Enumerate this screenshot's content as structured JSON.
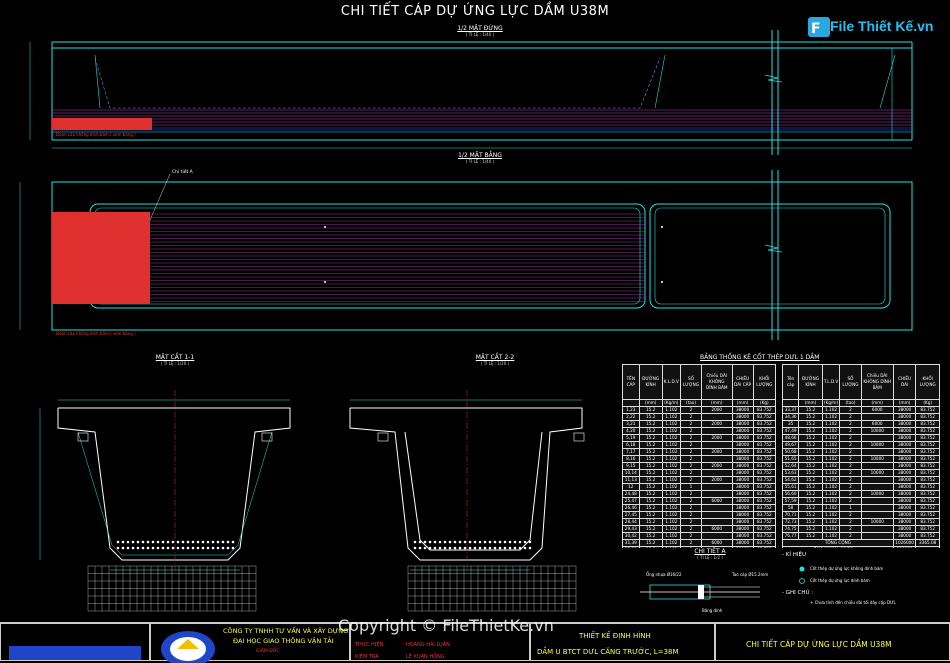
{
  "title": "CHI TIẾT CÁP DỰ ỨNG LỰC DẦM U38M",
  "logo_text": "File Thiết Kế.vn",
  "elevation": {
    "label": "1/2 MẶT ĐỨNG",
    "scale": "( TỈ LỆ : 1/40 )",
    "note": "Đoạn cáp không dính bám ( xem bảng )"
  },
  "plan": {
    "label": "1/2 MẶT BẰNG",
    "scale": "( TỈ LỆ : 1/40 )",
    "callout": "Chi tiết A",
    "note": "Đoạn cáp không dính bám ( xem bảng )"
  },
  "section1": {
    "label": "MẶT CẮT 1-1",
    "scale": "( TỈ LỆ : 1/20 )"
  },
  "section2": {
    "label": "MẶT CẮT 2-2",
    "scale": "( TỈ LỆ : 1/20 )"
  },
  "table_title": "BẢNG THỐNG KÊ CỐT THÉP DƯL 1 DẦM",
  "table_left": {
    "headers": [
      "TÊN CÁP",
      "ĐƯỜNG KÍNH",
      "K.L.D.V",
      "SỐ LƯỢNG",
      "Chiều DÀI KHÔNG DÍNH BÁM",
      "CHIỀU DÀI CÁP",
      "KHỐI LƯỢNG"
    ],
    "units": [
      "",
      "(mm)",
      "(Kg/m)",
      "(tao)",
      "(mm)",
      "(mm)",
      "(Kg)"
    ],
    "rows": [
      [
        "1,23",
        "15.2",
        "1.102",
        "2",
        "2000",
        "38000",
        "83.752"
      ],
      [
        "2,22",
        "15.2",
        "1.102",
        "2",
        "",
        "38000",
        "83.752"
      ],
      [
        "3,21",
        "15.2",
        "1.102",
        "2",
        "2000",
        "38000",
        "83.752"
      ],
      [
        "4,20",
        "15.2",
        "1.102",
        "2",
        "",
        "38000",
        "83.752"
      ],
      [
        "5,19",
        "15.2",
        "1.102",
        "2",
        "2000",
        "38000",
        "83.752"
      ],
      [
        "6,18",
        "15.2",
        "1.102",
        "2",
        "",
        "38000",
        "83.752"
      ],
      [
        "7,17",
        "15.2",
        "1.102",
        "2",
        "2000",
        "38000",
        "83.752"
      ],
      [
        "8,16",
        "15.2",
        "1.102",
        "2",
        "",
        "38000",
        "83.752"
      ],
      [
        "9,15",
        "15.2",
        "1.102",
        "2",
        "2000",
        "38000",
        "83.752"
      ],
      [
        "10,14",
        "15.2",
        "1.102",
        "2",
        "",
        "38000",
        "83.752"
      ],
      [
        "11,13",
        "15.2",
        "1.102",
        "2",
        "2000",
        "38000",
        "83.752"
      ],
      [
        "12",
        "15.2",
        "1.102",
        "1",
        "",
        "38000",
        "83.752"
      ],
      [
        "24,48",
        "15.2",
        "1.102",
        "2",
        "",
        "38000",
        "83.752"
      ],
      [
        "25,47",
        "15.2",
        "1.102",
        "2",
        "6000",
        "38000",
        "83.752"
      ],
      [
        "26,46",
        "15.2",
        "1.102",
        "2",
        "",
        "38000",
        "83.752"
      ],
      [
        "27,45",
        "15.2",
        "1.102",
        "2",
        "",
        "38000",
        "83.752"
      ],
      [
        "28,44",
        "15.2",
        "1.102",
        "2",
        "",
        "38000",
        "83.752"
      ],
      [
        "29,43",
        "15.2",
        "1.102",
        "2",
        "6000",
        "38000",
        "83.752"
      ],
      [
        "30,42",
        "15.2",
        "1.102",
        "2",
        "",
        "38000",
        "83.752"
      ],
      [
        "31,39",
        "15.2",
        "1.102",
        "2",
        "6000",
        "38000",
        "83.752"
      ],
      [
        "32,38",
        "15.2",
        "1.102",
        "2",
        "",
        "38000",
        "83.752"
      ]
    ]
  },
  "table_right": {
    "headers": [
      "Tên cáp",
      "ĐƯỜNG KÍNH",
      "T.L.D.V",
      "SỐ LƯỢNG",
      "Chiều DÀI KHÔNG DÍNH BÁM",
      "CHIỀU DÀI",
      "KHỐI LƯỢNG"
    ],
    "units": [
      "",
      "(mm)",
      "(Kg/m)",
      "(tao)",
      "(mm)",
      "(mm)",
      "(Kg)"
    ],
    "rows": [
      [
        "33,37",
        "15.2",
        "1.102",
        "2",
        "6000",
        "38000",
        "83.752"
      ],
      [
        "34,36",
        "15.2",
        "1.102",
        "2",
        "",
        "38000",
        "83.752"
      ],
      [
        "35",
        "15.2",
        "1.102",
        "2",
        "6000",
        "38000",
        "83.752"
      ],
      [
        "47,49",
        "15.2",
        "1.102",
        "2",
        "10000",
        "38000",
        "83.752"
      ],
      [
        "48,66",
        "15.2",
        "1.102",
        "2",
        "",
        "38000",
        "83.752"
      ],
      [
        "49,67",
        "15.2",
        "1.102",
        "2",
        "10000",
        "38000",
        "83.752"
      ],
      [
        "50,68",
        "15.2",
        "1.102",
        "2",
        "",
        "38000",
        "83.752"
      ],
      [
        "51,65",
        "15.2",
        "1.102",
        "2",
        "10000",
        "38000",
        "83.752"
      ],
      [
        "52,64",
        "15.2",
        "1.102",
        "2",
        "",
        "38000",
        "83.752"
      ],
      [
        "53,63",
        "15.2",
        "1.102",
        "2",
        "10000",
        "38000",
        "83.752"
      ],
      [
        "54,62",
        "15.2",
        "1.102",
        "2",
        "",
        "38000",
        "83.752"
      ],
      [
        "55,61",
        "15.2",
        "1.102",
        "2",
        "",
        "38000",
        "83.752"
      ],
      [
        "56,60",
        "15.2",
        "1.102",
        "2",
        "10000",
        "38000",
        "83.752"
      ],
      [
        "57,59",
        "15.2",
        "1.102",
        "2",
        "",
        "38000",
        "83.752"
      ],
      [
        "58",
        "15.2",
        "1.102",
        "1",
        "",
        "38000",
        "83.752"
      ],
      [
        "70,71",
        "15.2",
        "1.102",
        "2",
        "",
        "38000",
        "83.752"
      ],
      [
        "72,73",
        "15.2",
        "1.102",
        "2",
        "10000",
        "38000",
        "83.752"
      ],
      [
        "74,75",
        "15.2",
        "1.102",
        "2",
        "",
        "38000",
        "83.752"
      ],
      [
        "76,77",
        "15.2",
        "1.102",
        "2",
        "",
        "38000",
        "83.752"
      ]
    ],
    "total_label": "TỔNG CỘNG",
    "total_values": [
      "1026000",
      "3365.08"
    ],
    "note": "ỐNG NHỰA ⌀16/22 mm",
    "note_value": "118000"
  },
  "detail": {
    "label": "CHI TIẾT A",
    "scale": "( TỈ LỆ : 1/2 )",
    "pipe": "Ống nhựa Ø16/22",
    "strand": "Tao cáp Ø15.2mm",
    "tape": "Băng dính"
  },
  "legend": {
    "title": "- KÍ HIỆU",
    "item1": "Cốt thép dự ứng lực không dính bám",
    "item2": "Cốt thép dự ứng lực dính bám"
  },
  "notes": {
    "title": "- GHI CHÚ :",
    "text": "+ Chưa tính đến chiều dài tối dây cáp DƯL"
  },
  "title_block": {
    "company1": "CÔNG TY TNHH TƯ VẤN VÀ XÂY DỰNG",
    "company2": "ĐẠI HỌC GIAO THÔNG VẬN TẢI",
    "role": "GIÁM ĐỐC",
    "row1_role": "THỰC HIỆN",
    "row1_name": "HOÀNG HẢI LUÂN",
    "row2_role": "KIỂM TRA",
    "row2_name": "LÊ XUÂN HỒNG",
    "design1": "THIẾT KẾ ĐỊNH HÌNH",
    "design2": "DẦM U BTCT DƯL CĂNG TRƯỚC, L=38M",
    "sheet": "CHI TIẾT CÁP DỰ ỨNG LỰC DẦM U38M"
  },
  "watermark": "Copyright © FileThietKe.vn",
  "colors": {
    "cyan": "#22e0e0",
    "red": "#e03030",
    "magenta": "#c040c0",
    "blue": "#3050ff",
    "yellow": "#ffff40"
  }
}
